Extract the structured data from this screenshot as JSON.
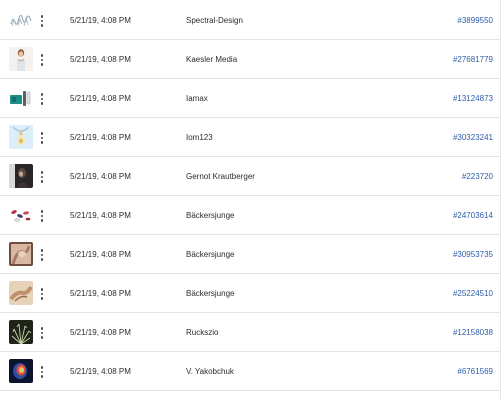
{
  "rows": [
    {
      "thumbnail": "thumbnail-sketch-figures",
      "date": "5/21/19, 4:08 PM",
      "author": "Spectral-Design",
      "id": "#3899550"
    },
    {
      "thumbnail": "thumbnail-woman-portrait",
      "date": "5/21/19, 4:08 PM",
      "author": "Kaesler Media",
      "id": "#27681779"
    },
    {
      "thumbnail": "thumbnail-tools",
      "date": "5/21/19, 4:08 PM",
      "author": "Iamax",
      "id": "#13124873"
    },
    {
      "thumbnail": "thumbnail-bottle-figure",
      "date": "5/21/19, 4:08 PM",
      "author": "Iom123",
      "id": "#30323241"
    },
    {
      "thumbnail": "thumbnail-dark-portrait",
      "date": "5/21/19, 4:08 PM",
      "author": "Gernot Krautberger",
      "id": "#223720"
    },
    {
      "thumbnail": "thumbnail-pills",
      "date": "5/21/19, 4:08 PM",
      "author": "Bäckersjunge",
      "id": "#24703614"
    },
    {
      "thumbnail": "thumbnail-hands-warm",
      "date": "5/21/19, 4:08 PM",
      "author": "Bäckersjunge",
      "id": "#30953735"
    },
    {
      "thumbnail": "thumbnail-hands-beige",
      "date": "5/21/19, 4:08 PM",
      "author": "Bäckersjunge",
      "id": "#25224510"
    },
    {
      "thumbnail": "thumbnail-plant-dark",
      "date": "5/21/19, 4:08 PM",
      "author": "Ruckszio",
      "id": "#12158038"
    },
    {
      "thumbnail": "thumbnail-brain-scan",
      "date": "5/21/19, 4:08 PM",
      "author": "V. Yakobchuk",
      "id": "#6761569"
    }
  ],
  "colors": {
    "link": "#2d5ea8",
    "text": "#2c2c2c",
    "divider": "#e4e4e4"
  }
}
